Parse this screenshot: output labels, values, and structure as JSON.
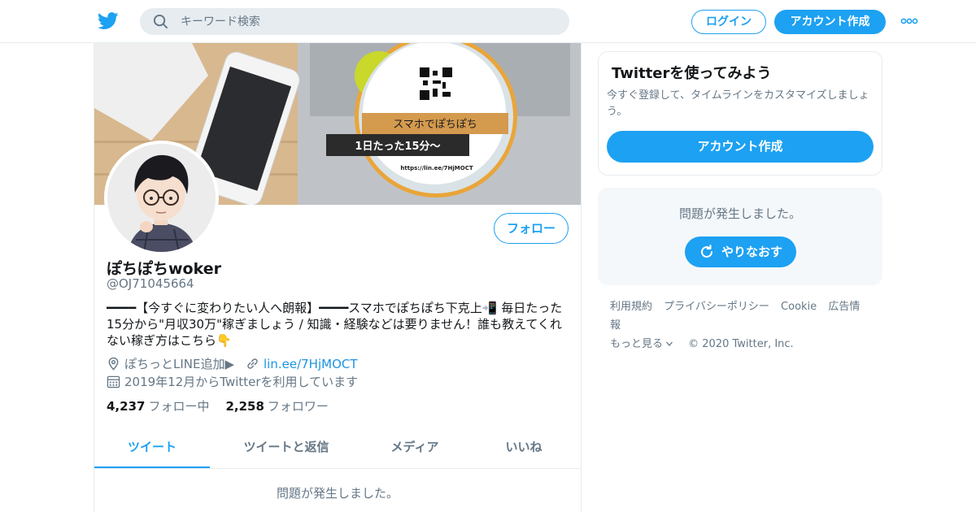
{
  "header": {
    "search_placeholder": "キーワード検索",
    "login_label": "ログイン",
    "signup_label": "アカウント作成",
    "icons": {
      "logo": "twitter-bird-icon",
      "search": "search-icon",
      "more": "more-dots-icon"
    }
  },
  "profile": {
    "banner": {
      "title": "スマホでぽちぽち",
      "subtitle": "1日たった15分〜",
      "url": "https://lin.ee/7HjMOCT"
    },
    "follow_label": "フォロー",
    "display_name": "ぽちぽちwoker",
    "handle": "@OJ71045664",
    "bio": "━━━━【今すぐに変わりたい人へ朗報】━━━━スマホでぽちぽち下克上📲 毎日たった15分から\"月収30万\"稼ぎましょう / 知識・経験などは要りません！誰も教えてくれない稼ぎ方はこちら👇",
    "location": "ぽちっとLINE追加▶",
    "url": "lin.ee/7HjMOCT",
    "joined": "2019年12月からTwitterを利用しています",
    "following_count": "4,237",
    "following_label": "フォロー中",
    "followers_count": "2,258",
    "followers_label": "フォロワー",
    "tabs": [
      {
        "label": "ツイート",
        "active": true
      },
      {
        "label": "ツイートと返信",
        "active": false
      },
      {
        "label": "メディア",
        "active": false
      },
      {
        "label": "いいね",
        "active": false
      }
    ],
    "timeline_error": "問題が発生しました。"
  },
  "sidebar": {
    "try_title": "Twitterを使ってみよう",
    "try_text": "今すぐ登録して、タイムラインをカスタマイズしましょう。",
    "try_button": "アカウント作成",
    "error_text": "問題が発生しました。",
    "retry_label": "やりなおす",
    "footer": {
      "terms": "利用規約",
      "privacy": "プライバシーポリシー",
      "cookie": "Cookie",
      "ads": "広告情報",
      "more": "もっと見る",
      "copyright": "© 2020 Twitter, Inc."
    }
  },
  "colors": {
    "accent": "#1da1f2",
    "text": "#14171a",
    "secondary": "#657786",
    "border": "#e6ecf0"
  }
}
